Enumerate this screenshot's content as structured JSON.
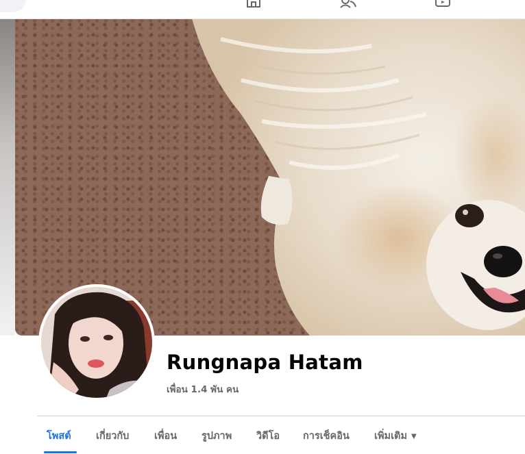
{
  "header": {
    "icons": [
      "home-icon",
      "friends-icon",
      "watch-icon"
    ]
  },
  "profile": {
    "name": "Rungnapa Hatam",
    "friends_count": "เพื่อน 1.4 พัน คน"
  },
  "tabs": [
    {
      "label": "โพสต์",
      "active": true
    },
    {
      "label": "เกี่ยวกับ",
      "active": false
    },
    {
      "label": "เพื่อน",
      "active": false
    },
    {
      "label": "รูปภาพ",
      "active": false
    },
    {
      "label": "วิดีโอ",
      "active": false
    },
    {
      "label": "การเช็คอิน",
      "active": false
    },
    {
      "label": "เพิ่มเติม",
      "active": false,
      "dropdown": true
    }
  ],
  "colors": {
    "accent": "#1b74e4",
    "text_primary": "#050505",
    "text_secondary": "#65676b",
    "divider": "#ced0d4"
  }
}
